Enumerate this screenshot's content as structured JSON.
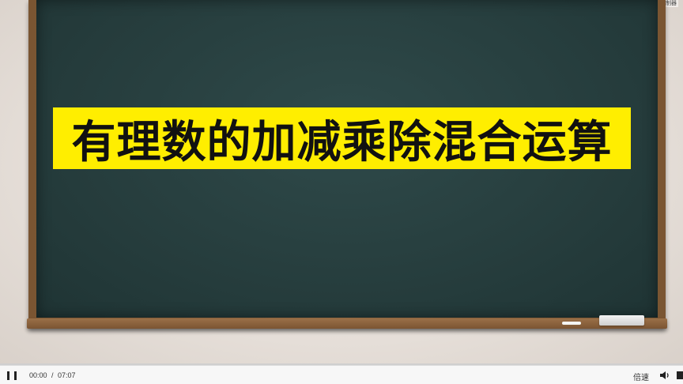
{
  "top_corner": {
    "text": "讲 控制器"
  },
  "title": {
    "text": "有理数的加减乘除混合运算"
  },
  "colors": {
    "banner": "#ffee00",
    "board": "#263d3d",
    "frame": "#8f6640",
    "progress": "#3a8ee6"
  },
  "player": {
    "current_time": "00:00",
    "separator": "/",
    "total_time": "07:07",
    "speed_label": "倍速",
    "progress_fraction": 0.0,
    "icons": [
      "pause-icon",
      "volume-icon",
      "fullscreen-icon"
    ]
  }
}
